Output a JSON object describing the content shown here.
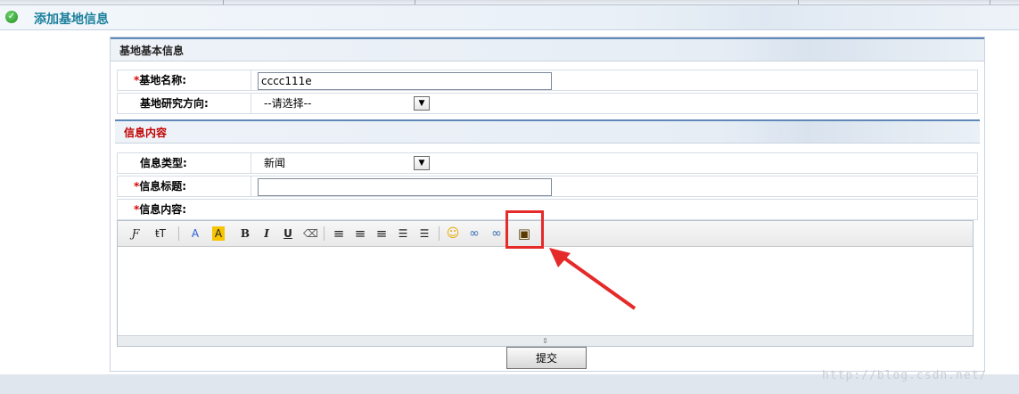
{
  "page": {
    "title": "添加基地信息",
    "submit_label": "提交",
    "watermark": "http://blog.csdn.net/"
  },
  "section_basic": {
    "header": "基地基本信息",
    "fields": {
      "name_label": "基地名称:",
      "name_value": "cccc111e",
      "direction_label": "基地研究方向:",
      "direction_selected": "--请选择--"
    }
  },
  "section_info": {
    "header": "信息内容",
    "fields": {
      "type_label": "信息类型:",
      "type_selected": "新闻",
      "title_label": "信息标题:",
      "title_value": "",
      "content_label": "信息内容:"
    }
  },
  "required_mark": "*",
  "editor": {
    "toolbar": [
      {
        "name": "font-family-icon",
        "glyph": "Ƒ"
      },
      {
        "name": "font-size-icon",
        "glyph": "ŧT"
      },
      {
        "name": "font-color-icon",
        "glyph": "A"
      },
      {
        "name": "highlight-color-icon",
        "glyph": "A"
      },
      {
        "name": "bold-icon",
        "glyph": "B"
      },
      {
        "name": "italic-icon",
        "glyph": "I"
      },
      {
        "name": "underline-icon",
        "glyph": "U"
      },
      {
        "name": "eraser-icon",
        "glyph": "⌫"
      },
      {
        "name": "align-left-icon",
        "glyph": "≡"
      },
      {
        "name": "align-center-icon",
        "glyph": "≡"
      },
      {
        "name": "align-right-icon",
        "glyph": "≡"
      },
      {
        "name": "ordered-list-icon",
        "glyph": "☰"
      },
      {
        "name": "unordered-list-icon",
        "glyph": "☰"
      },
      {
        "name": "emoticon-icon",
        "glyph": "☺"
      },
      {
        "name": "link-icon",
        "glyph": "∞"
      },
      {
        "name": "unlink-icon",
        "glyph": "∞"
      },
      {
        "name": "insert-image-icon",
        "glyph": "▣"
      }
    ]
  },
  "colors": {
    "title": "#1a7f9c",
    "required": "#d00000",
    "section_info_header": "#c00000",
    "highlight": "#e52a2a",
    "accent_border": "#5f88b8"
  }
}
